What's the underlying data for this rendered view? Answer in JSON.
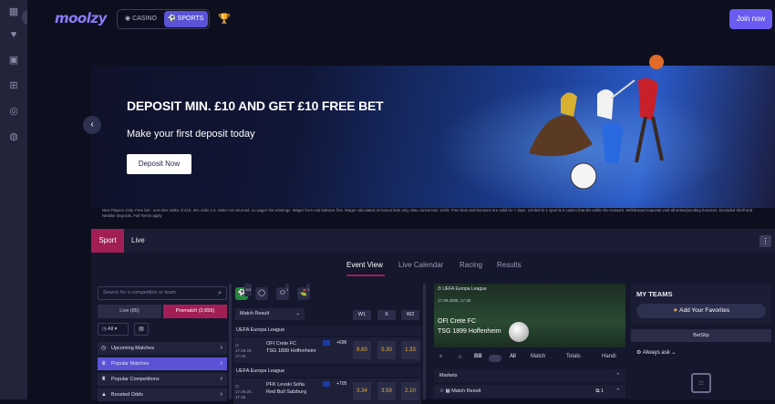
{
  "app": {
    "logo_text": "moolzy",
    "accent": "#6a5cf0",
    "sport_accent": "#a21f55"
  },
  "rail": {
    "icons": [
      "grid-icon",
      "heart-icon",
      "slots-icon",
      "gift-icon",
      "chip-icon",
      "chat-icon"
    ]
  },
  "header": {
    "casino_label": "CASINO",
    "sports_label": "SPORTS",
    "join_label": "Join now"
  },
  "banner": {
    "headline": "DEPOSIT MIN. £10 AND GET £10 FREE BET",
    "subhead": "Make your first deposit today",
    "cta": "Deposit Now",
    "fine_print": "New Players Only. Free bet - one-time stake of £10, min odds 1.5, stake not returned. 1x wager the winnings. Wager from real balance first. Wager calculated on bonus bets only. Max conversion: £200. Free bets and bonuses are valid for 7 days. Limited to 1 sport & 5 casino brand/s within the network. Withdrawal requests void all active/pending bonuses. Excluded Skrill and Neteller deposits. Full Terms apply"
  },
  "sport_tabs": {
    "sport": "Sport",
    "live": "Live"
  },
  "subtabs": [
    "Event View",
    "Live Calendar",
    "Racing",
    "Results"
  ],
  "left": {
    "search_placeholder": "Search for a competition or team",
    "live_btn": "Live (85)",
    "prematch_btn": "Prematch (2,656)",
    "all_label": "All",
    "menu": [
      "Upcoming Matches",
      "Popular Matches",
      "Popular Competitions",
      "Boosted Odds"
    ]
  },
  "mid": {
    "sport_counts": [
      "113",
      "",
      "1",
      "1"
    ],
    "market_select": "Match Result",
    "cols": [
      "W1",
      "X",
      "W2"
    ],
    "league": "UEFA Europa League",
    "matches": [
      {
        "date": "17.09.26.",
        "time": "17:45",
        "home": "OFI Crete FC",
        "away": "TSG 1899 Hoffenheim",
        "more": "+696",
        "w1": "8.60",
        "x": "5.30",
        "w2": "1.33"
      },
      {
        "date": "17.09.26.",
        "time": "17:45",
        "home": "PFK Levski Sofia",
        "away": "Red Bull Salzburg",
        "more": "+705",
        "w1": "3.34",
        "x": "3.59",
        "w2": "2.10"
      }
    ]
  },
  "detail": {
    "league": "UEFA Europa League",
    "date": "17.09.2026, 17:45",
    "home": "OFI Crete FC",
    "away": "TSG 1899 Hoffenheim",
    "filters": [
      "All",
      "Match",
      "Totals",
      "Handi"
    ],
    "markets_label": "Markets",
    "market_row": "Match Result",
    "market_count": "1"
  },
  "right": {
    "my_teams": "MY TEAMS",
    "add_fav": "Add Your Favorites",
    "betslip": "BetSlip",
    "always_ask": "Always ask"
  }
}
